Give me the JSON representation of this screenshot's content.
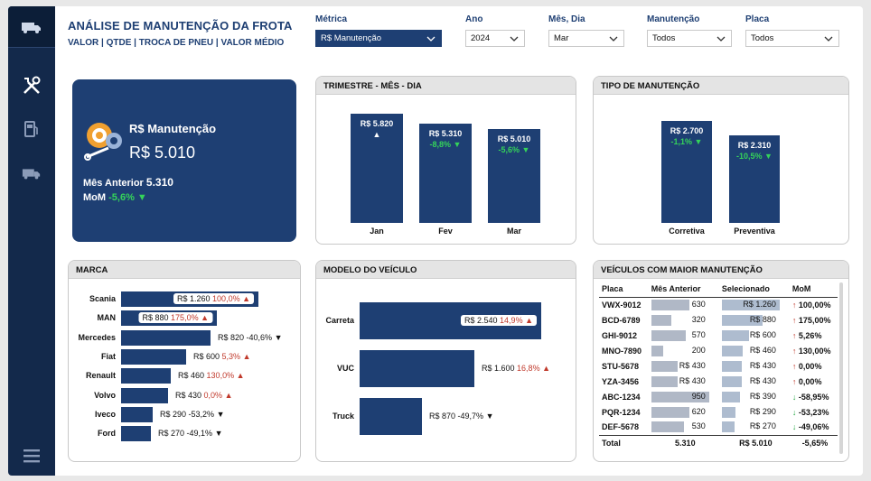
{
  "header": {
    "title": "ANÁLISE DE MANUTENÇÃO DA FROTA",
    "subtitle": "VALOR | QTDE | TROCA DE PNEU | VALOR MÉDIO"
  },
  "filters": {
    "metric": {
      "label": "Métrica",
      "value": "R$ Manutenção"
    },
    "year": {
      "label": "Ano",
      "value": "2024"
    },
    "month": {
      "label": "Mês, Dia",
      "value": "Mar"
    },
    "maint": {
      "label": "Manutenção",
      "value": "Todos"
    },
    "plate": {
      "label": "Placa",
      "value": "Todos"
    }
  },
  "kpi": {
    "title": "R$ Manutenção",
    "value": "R$ 5.010",
    "prev_label": "Mês Anterior",
    "prev_value": "5.310",
    "mom_label": "MoM",
    "mom_value": "-5,6%"
  },
  "trimestre": {
    "title": "TRIMESTRE - MÊS - DIA",
    "bars": [
      {
        "label": "Jan",
        "value_text": "R$ 5.820",
        "delta": "",
        "value": 5820
      },
      {
        "label": "Fev",
        "value_text": "R$ 5.310",
        "delta": "-8,8%",
        "value": 5310
      },
      {
        "label": "Mar",
        "value_text": "R$ 5.010",
        "delta": "-5,6%",
        "value": 5010
      }
    ]
  },
  "tipo": {
    "title": "TIPO DE MANUTENÇÃO",
    "bars": [
      {
        "label": "Corretiva",
        "value_text": "R$ 2.700",
        "delta": "-1,1%",
        "value": 2700
      },
      {
        "label": "Preventiva",
        "value_text": "R$ 2.310",
        "delta": "-10,5%",
        "value": 2310
      }
    ]
  },
  "marca": {
    "title": "MARCA",
    "rows": [
      {
        "name": "Scania",
        "value_text": "R$ 1.260",
        "delta": "100,0%",
        "dir": "up",
        "value": 1260
      },
      {
        "name": "MAN",
        "value_text": "R$ 880",
        "delta": "175,0%",
        "dir": "up",
        "value": 880
      },
      {
        "name": "Mercedes",
        "value_text": "R$ 820",
        "delta": "-40,6%",
        "dir": "down",
        "value": 820
      },
      {
        "name": "Fiat",
        "value_text": "R$ 600",
        "delta": "5,3%",
        "dir": "up",
        "value": 600
      },
      {
        "name": "Renault",
        "value_text": "R$ 460",
        "delta": "130,0%",
        "dir": "up",
        "value": 460
      },
      {
        "name": "Volvo",
        "value_text": "R$ 430",
        "delta": "0,0%",
        "dir": "up",
        "value": 430
      },
      {
        "name": "Iveco",
        "value_text": "R$ 290",
        "delta": "-53,2%",
        "dir": "down",
        "value": 290
      },
      {
        "name": "Ford",
        "value_text": "R$ 270",
        "delta": "-49,1%",
        "dir": "down",
        "value": 270
      }
    ]
  },
  "modelo": {
    "title": "MODELO DO VEÍCULO",
    "rows": [
      {
        "name": "Carreta",
        "value_text": "R$ 2.540",
        "delta": "14,9%",
        "dir": "up",
        "value": 2540
      },
      {
        "name": "VUC",
        "value_text": "R$ 1.600",
        "delta": "16,8%",
        "dir": "up",
        "value": 1600
      },
      {
        "name": "Truck",
        "value_text": "R$ 870",
        "delta": "-49,7%",
        "dir": "down",
        "value": 870
      }
    ]
  },
  "veiculos": {
    "title": "VEÍCULOS COM MAIOR MANUTENÇÃO",
    "columns": [
      "Placa",
      "Mês Anterior",
      "Selecionado",
      "MoM"
    ],
    "rows": [
      {
        "placa": "VWX-9012",
        "ant": "630",
        "ant_v": 630,
        "sel": "R$ 1.260",
        "sel_v": 1260,
        "mom": "100,00%",
        "dir": "up"
      },
      {
        "placa": "BCD-6789",
        "ant": "320",
        "ant_v": 320,
        "sel": "R$ 880",
        "sel_v": 880,
        "mom": "175,00%",
        "dir": "up"
      },
      {
        "placa": "GHI-9012",
        "ant": "570",
        "ant_v": 570,
        "sel": "R$ 600",
        "sel_v": 600,
        "mom": "5,26%",
        "dir": "up"
      },
      {
        "placa": "MNO-7890",
        "ant": "200",
        "ant_v": 200,
        "sel": "R$ 460",
        "sel_v": 460,
        "mom": "130,00%",
        "dir": "up"
      },
      {
        "placa": "STU-5678",
        "ant": "R$ 430",
        "ant_v": 430,
        "sel": "R$ 430",
        "sel_v": 430,
        "mom": "0,00%",
        "dir": "up"
      },
      {
        "placa": "YZA-3456",
        "ant": "R$ 430",
        "ant_v": 430,
        "sel": "R$ 430",
        "sel_v": 430,
        "mom": "0,00%",
        "dir": "up"
      },
      {
        "placa": "ABC-1234",
        "ant": "950",
        "ant_v": 950,
        "sel": "R$ 390",
        "sel_v": 390,
        "mom": "-58,95%",
        "dir": "down"
      },
      {
        "placa": "PQR-1234",
        "ant": "620",
        "ant_v": 620,
        "sel": "R$ 290",
        "sel_v": 290,
        "mom": "-53,23%",
        "dir": "down"
      },
      {
        "placa": "DEF-5678",
        "ant": "530",
        "ant_v": 530,
        "sel": "R$ 270",
        "sel_v": 270,
        "mom": "-49,06%",
        "dir": "down"
      }
    ],
    "total": {
      "label": "Total",
      "ant": "5.310",
      "sel": "R$ 5.010",
      "mom": "-5,65%"
    }
  },
  "colors": {
    "navy": "#1e3f73",
    "sidebar": "#13294b",
    "green": "#35d35a",
    "red": "#c0392b"
  },
  "icons": [
    "truck-icon",
    "tools-icon",
    "fuel-icon",
    "truck-icon",
    "menu-icon",
    "gear-icon"
  ]
}
